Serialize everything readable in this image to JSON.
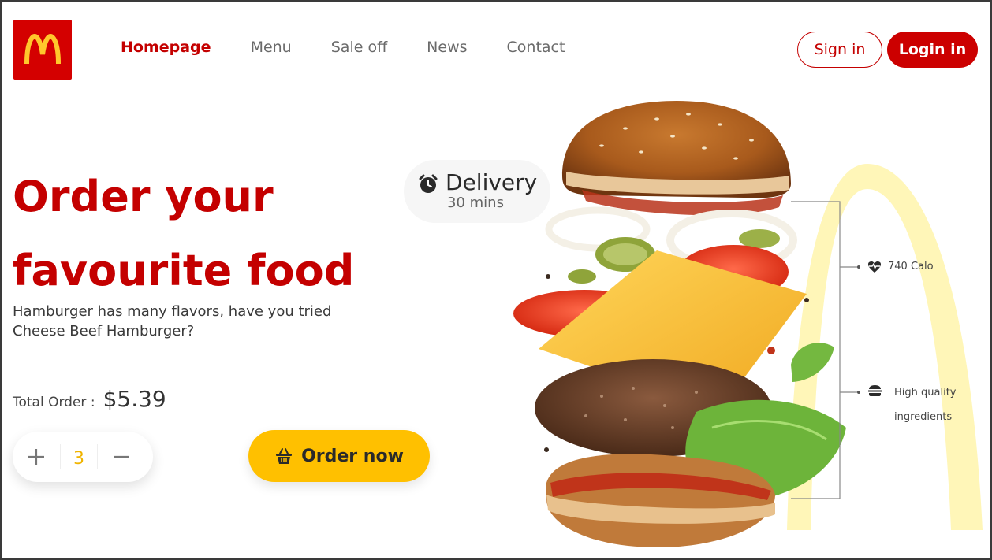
{
  "brand": {
    "logo_icon": "mcdonalds-arches-icon",
    "colors": {
      "primary": "#cc0000",
      "accent": "#ffc000",
      "arch": "#fff6b8"
    }
  },
  "nav": {
    "items": [
      {
        "label": "Homepage",
        "active": true
      },
      {
        "label": "Menu",
        "active": false
      },
      {
        "label": "Sale off",
        "active": false
      },
      {
        "label": "News",
        "active": false
      },
      {
        "label": "Contact",
        "active": false
      }
    ]
  },
  "auth": {
    "sign_in": "Sign in",
    "log_in": "Login in"
  },
  "hero": {
    "headline_line1": "Order your",
    "headline_line2": "favourite food",
    "subtext": "Hamburger has many flavors, have you tried Cheese Beef Hamburger?",
    "total_label": "Total Order :",
    "total_price": "$5.39",
    "quantity": "3",
    "order_button": "Order now"
  },
  "delivery": {
    "title": "Delivery",
    "subtitle": "30 mins",
    "icon": "alarm-clock-icon"
  },
  "features": [
    {
      "icon": "heart-pulse-icon",
      "label": "740 Calo"
    },
    {
      "icon": "burger-icon",
      "label": "High quality ingredients"
    }
  ]
}
